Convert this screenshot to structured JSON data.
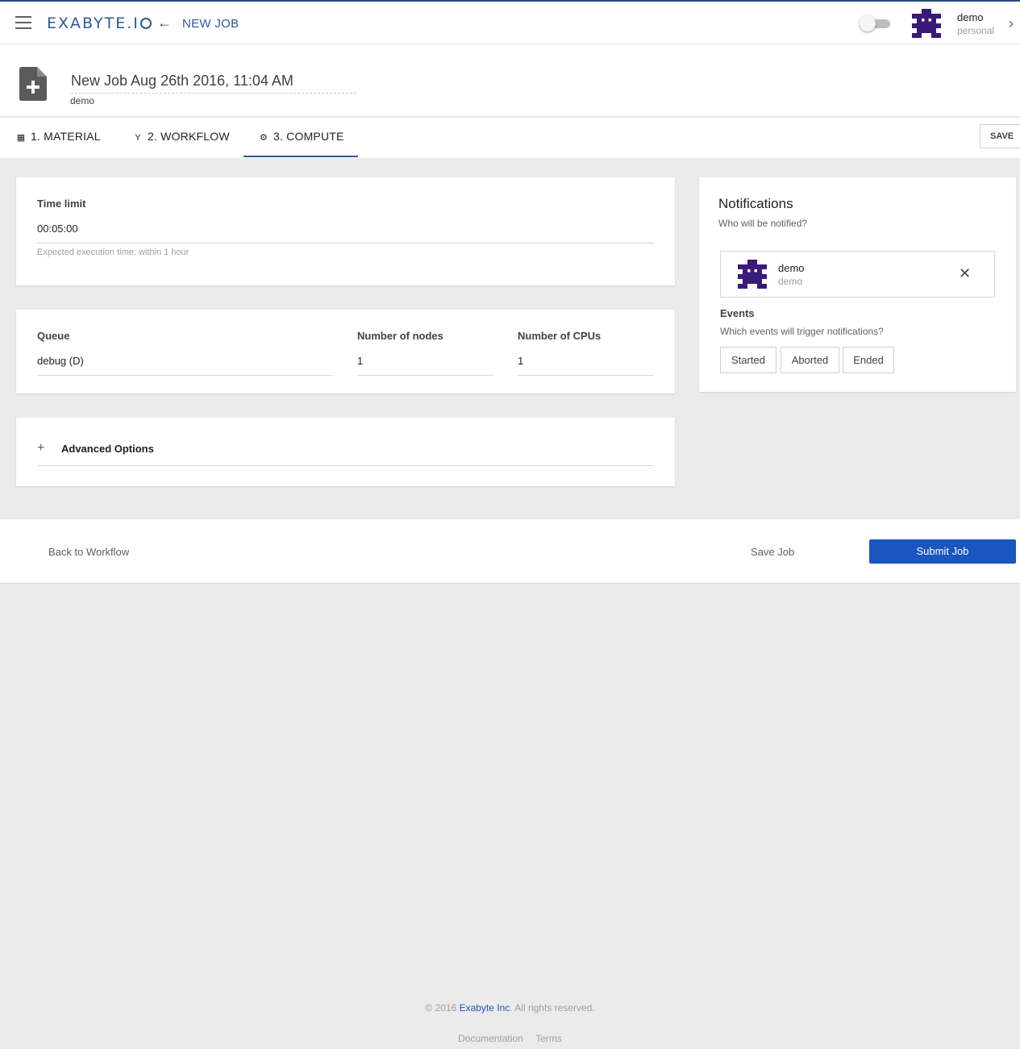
{
  "header": {
    "logo_text": "EXABYTE.I",
    "page_title": "NEW JOB",
    "user_name": "demo",
    "user_account": "personal"
  },
  "job": {
    "name": "New Job Aug 26th 2016, 11:04 AM",
    "owner": "demo"
  },
  "tabs": [
    {
      "label": "1. MATERIAL",
      "icon": "grid-icon"
    },
    {
      "label": "2. WORKFLOW",
      "icon": "branch-icon"
    },
    {
      "label": "3. COMPUTE",
      "icon": "gear-icon",
      "active": true
    }
  ],
  "save_label": "SAVE",
  "time_limit": {
    "label": "Time limit",
    "value": "00:05:00",
    "hint": "Expected execution time: within 1 hour"
  },
  "resources": {
    "queue_label": "Queue",
    "queue_value": "debug (D)",
    "nodes_label": "Number of nodes",
    "nodes_value": "1",
    "cpus_label": "Number of CPUs",
    "cpus_value": "1"
  },
  "advanced": {
    "label": "Advanced Options"
  },
  "notifications": {
    "title": "Notifications",
    "subtitle": "Who will be notified?",
    "recipient_name": "demo",
    "recipient_sub": "demo",
    "events_title": "Events",
    "events_subtitle": "Which events will trigger notifications?",
    "events": [
      "Started",
      "Aborted",
      "Ended"
    ]
  },
  "actions": {
    "back": "Back to Workflow",
    "save": "Save Job",
    "submit": "Submit Job"
  },
  "footer": {
    "copyright_prefix": "© 2016 ",
    "brand": "Exabyte Inc",
    "copyright_suffix": ". All rights reserved.",
    "links": [
      "Documentation",
      "Terms"
    ]
  },
  "colors": {
    "brand": "#2d5a9a",
    "primary_button": "#1a55c0",
    "avatar": "#3a1a78"
  }
}
